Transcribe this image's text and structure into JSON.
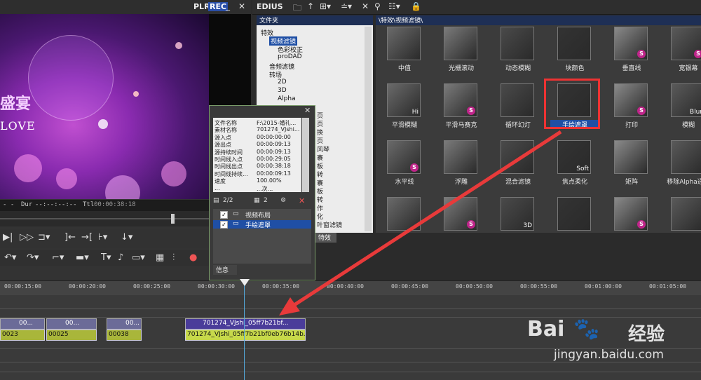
{
  "preview": {
    "plr": "PLR",
    "rec": "REC",
    "minimize": "_",
    "close": "✕",
    "overlay_title": "盛宴",
    "overlay_love": "LOVE",
    "dur_label": "Dur",
    "dur_value": "--:--:--:--",
    "ttl_label": "Ttl",
    "ttl_value": "00:00:38:18",
    "in_value": "- -"
  },
  "edius": {
    "title": "EDIUS",
    "tree_header": "文件夹",
    "fx_header": "\\特效\\视频滤镜\\",
    "tree": [
      {
        "label": "特效",
        "indent": 0
      },
      {
        "label": "视频滤镜",
        "indent": 1,
        "selected": true
      },
      {
        "label": "色彩校正",
        "indent": 2
      },
      {
        "label": "proDAD",
        "indent": 2
      },
      {
        "label": "音频滤镜",
        "indent": 1
      },
      {
        "label": "转场",
        "indent": 1
      },
      {
        "label": "2D",
        "indent": 2
      },
      {
        "label": "3D",
        "indent": 2
      },
      {
        "label": "Alpha",
        "indent": 2
      }
    ],
    "tree_partial": [
      "页",
      "页",
      "换",
      "页",
      "风琴",
      "褰",
      "板",
      "转",
      "褰",
      "板",
      "转",
      "作",
      "化",
      "叶窗滤镜"
    ],
    "special_tab": "特效"
  },
  "effects": [
    {
      "label": "中值"
    },
    {
      "label": "光栅滚动"
    },
    {
      "label": "动态模糊"
    },
    {
      "label": "块颜色"
    },
    {
      "label": "垂直线",
      "s": "S"
    },
    {
      "label": "宽银幕",
      "s": "S"
    },
    {
      "label": "平滑模糊",
      "hi": "Hi"
    },
    {
      "label": "平滑马赛克",
      "s": "S"
    },
    {
      "label": "循环幻灯"
    },
    {
      "label": "手绘遮罩",
      "highlight": true
    },
    {
      "label": "打印",
      "s": "S"
    },
    {
      "label": "模糊",
      "hi": "Blur"
    },
    {
      "label": "水平线",
      "s": "S"
    },
    {
      "label": "浮雕"
    },
    {
      "label": "混合滤镜"
    },
    {
      "label": "焦点柔化",
      "hi": "Soft"
    },
    {
      "label": "矩阵"
    },
    {
      "label": "移除Alpha通道"
    },
    {
      "label": ""
    },
    {
      "label": "",
      "s": "S"
    },
    {
      "label": "",
      "hi": "3D"
    },
    {
      "label": ""
    },
    {
      "label": "",
      "s": "S"
    },
    {
      "label": ""
    }
  ],
  "popup": {
    "close": "✕",
    "rows": [
      {
        "k": "文件名称",
        "v": "F:\\2015-婚礼..."
      },
      {
        "k": "素材名称",
        "v": "701274_VJshi..."
      },
      {
        "k": "源入点",
        "v": "00:00:00:00"
      },
      {
        "k": "源出点",
        "v": "00:00:09:13"
      },
      {
        "k": "源持续时间",
        "v": "00:00:09:13"
      },
      {
        "k": "时间线入点",
        "v": "00:00:29:05"
      },
      {
        "k": "时间线出点",
        "v": "00:00:38:18"
      },
      {
        "k": "时间线持续...",
        "v": "00:00:09:13"
      },
      {
        "k": "速度",
        "v": "100.00%"
      },
      {
        "k": "...",
        "v": "...次..."
      }
    ],
    "counter": "2/2",
    "counter2": "2",
    "list": [
      {
        "label": "视频布局",
        "checked": true
      },
      {
        "label": "手绘遮罩",
        "checked": true,
        "selected": true
      }
    ],
    "info_tab": "信息"
  },
  "timeline": {
    "ticks": [
      "00:00:15:00",
      "00:00:20:00",
      "00:00:25:00",
      "00:00:30:00",
      "00:00:35:00",
      "00:00:40:00",
      "00:00:45:00",
      "00:00:50:00",
      "00:00:55:00",
      "00:01:00:00",
      "00:01:05:00"
    ],
    "clips_v": [
      {
        "label": "00..."
      },
      {
        "label": "00..."
      },
      {
        "label": "00..."
      },
      {
        "label": "701274_VJshi_05ff7b21bf..."
      }
    ],
    "clips_a": [
      {
        "label": "0023"
      },
      {
        "label": "00025"
      },
      {
        "label": "00038"
      },
      {
        "label": "701274_VJshi_05ff7b21bf0eb76b14b..."
      }
    ]
  },
  "watermark": {
    "brand": "Bai",
    "brand2": "经验",
    "url": "jingyan.baidu.com"
  },
  "colors": {
    "highlight_box": "#e33333",
    "selection": "#1f4fa5",
    "arrow": "#e83a3a"
  }
}
